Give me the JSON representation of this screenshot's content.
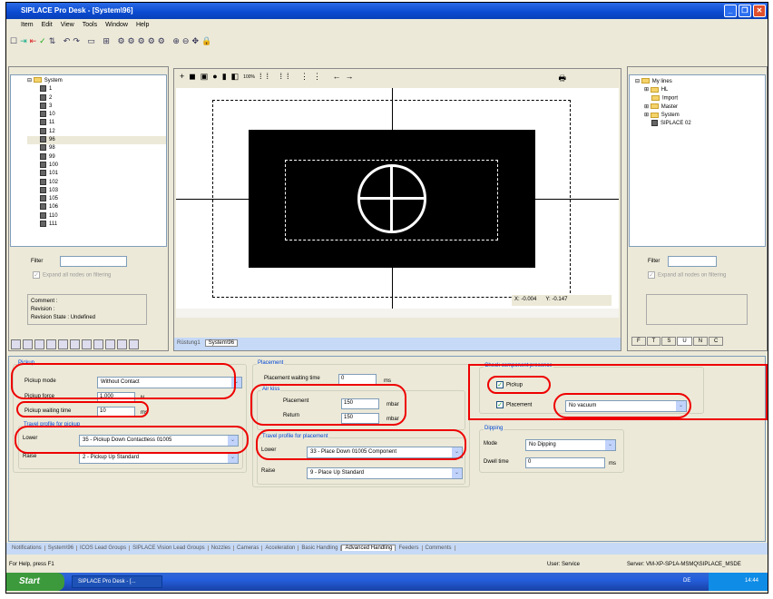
{
  "window": {
    "title": "SIPLACE Pro Desk - [System\\96]",
    "minimize": "_",
    "restore": "❐",
    "close": "✕"
  },
  "menu": [
    "Item",
    "Edit",
    "View",
    "Tools",
    "Window",
    "Help"
  ],
  "toolbar_icons": [
    "new-icon",
    "import-icon",
    "export-icon",
    "check-icon",
    "sort-icon",
    "undo-icon",
    "redo-icon",
    "view-icon",
    "grid-icon",
    "zoom-in-icon",
    "zoom-out-icon",
    "zoom-100-icon",
    "lock-icon"
  ],
  "left_panel": {
    "tree_root": "System",
    "tree_items": [
      "1",
      "2",
      "3",
      "10",
      "11",
      "12",
      "96",
      "98",
      "99",
      "100",
      "101",
      "102",
      "103",
      "105",
      "106",
      "110",
      "111"
    ],
    "filter_label": "Filter",
    "expand_label": "Expand all nodes on filtering",
    "comment": "Comment :",
    "revision": "Revision :",
    "revision_state": "Revision State : Undefined"
  },
  "canvas": {
    "x_label": "X:",
    "x_value": "-0.004",
    "y_label": "Y:",
    "y_value": "-0.147",
    "doc_tabs": [
      "Rüstung1",
      "System\\96"
    ],
    "zoom_label": "100%"
  },
  "right_panel": {
    "tree": [
      {
        "label": "My lines",
        "type": "folder"
      },
      {
        "label": "HL",
        "type": "folder"
      },
      {
        "label": "Import",
        "type": "folder"
      },
      {
        "label": "Master",
        "type": "folder"
      },
      {
        "label": "System",
        "type": "folder"
      },
      {
        "label": "SIPLACE 02",
        "type": "line"
      }
    ],
    "filter_label": "Filter",
    "expand_label": "Expand all nodes on filtering",
    "bottom_tabs": [
      "F",
      "T",
      "S",
      "U",
      "N",
      "C"
    ]
  },
  "form": {
    "pickup": {
      "title": "Pickup",
      "mode_label": "Pickup mode",
      "mode_value": "Without Contact",
      "force_label": "Pickup force",
      "force_value": "1.000",
      "force_unit": "N",
      "wait_label": "Pickup waiting time",
      "wait_value": "10",
      "wait_unit": "ms"
    },
    "travel_pickup": {
      "title": "Travel profile for pickup",
      "lower_label": "Lower",
      "lower_value": "35 - Pickup Down Contactless 01005",
      "raise_label": "Raise",
      "raise_value": "2 - Pickup Up Standard"
    },
    "placement": {
      "title": "Placement",
      "wait_label": "Placement waiting time",
      "wait_value": "0",
      "wait_unit": "ms"
    },
    "air_kiss": {
      "title": "Air kiss",
      "placement_label": "Placement",
      "placement_value": "150",
      "placement_unit": "mbar",
      "return_label": "Return",
      "return_value": "150",
      "return_unit": "mbar"
    },
    "travel_placement": {
      "title": "Travel profile for placement",
      "lower_label": "Lower",
      "lower_value": "33 - Place Down 01005 Component",
      "raise_label": "Raise",
      "raise_value": "9 - Place Up Standard"
    },
    "check": {
      "title": "Check component presence",
      "pickup_label": "Pickup",
      "pickup_checked": true,
      "placement_label": "Placement",
      "placement_checked": true,
      "placement_value": "No vacuum"
    },
    "dipping": {
      "title": "Dipping",
      "mode_label": "Mode",
      "mode_value": "No Dipping",
      "dwell_label": "Dwell time",
      "dwell_value": "0",
      "dwell_unit": "ms"
    }
  },
  "tabs": [
    "Notifications",
    "System\\96",
    "ICOS Lead Groups",
    "SIPLACE Vision Lead Groups",
    "Nozzles",
    "Cameras",
    "Acceleration",
    "Basic Handling",
    "Advanced Handling",
    "Feeders",
    "Comments"
  ],
  "status": {
    "help": "For Help, press F1",
    "user": "User:  Service",
    "server": "Server:  VM-XP-SP1A-MSMQ\\SIPLACE_MSDE"
  },
  "taskbar": {
    "start": "Start",
    "task": "SIPLACE Pro Desk - [...",
    "lang": "DE",
    "time": "14:44"
  }
}
